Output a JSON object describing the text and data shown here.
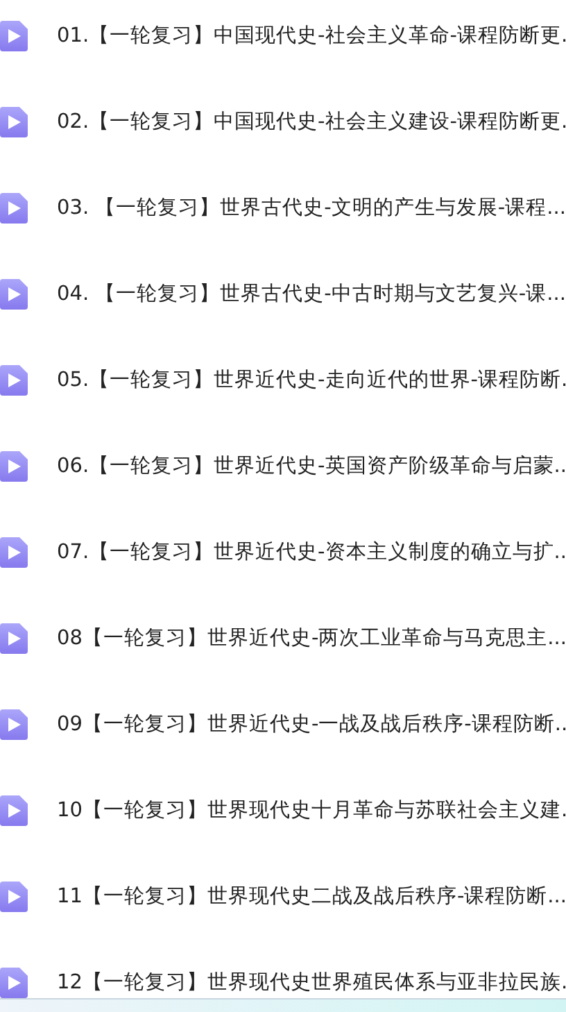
{
  "items": [
    {
      "title": "01.【一轮复习】中国现代史-社会主义革命-课程防断更."
    },
    {
      "title": "02.【一轮复习】中国现代史-社会主义建设-课程防断更."
    },
    {
      "title": "03. 【一轮复习】世界古代史-文明的产生与发展-课程..."
    },
    {
      "title": "04. 【一轮复习】世界古代史-中古时期与文艺复兴-课..."
    },
    {
      "title": "05.【一轮复习】世界近代史-走向近代的世界-课程防断."
    },
    {
      "title": "06.【一轮复习】世界近代史-英国资产阶级革命与启蒙.."
    },
    {
      "title": "07.【一轮复习】世界近代史-资本主义制度的确立与扩.."
    },
    {
      "title": "08【一轮复习】世界近代史-两次工业革命与马克思主..."
    },
    {
      "title": "09【一轮复习】世界近代史-一战及战后秩序-课程防断.."
    },
    {
      "title": "10【一轮复习】世界现代史十月革命与苏联社会主义建."
    },
    {
      "title": "11【一轮复习】世界现代史二战及战后秩序-课程防断..."
    },
    {
      "title": "12【一轮复习】世界现代史世界殖民体系与亚非拉民族."
    }
  ]
}
